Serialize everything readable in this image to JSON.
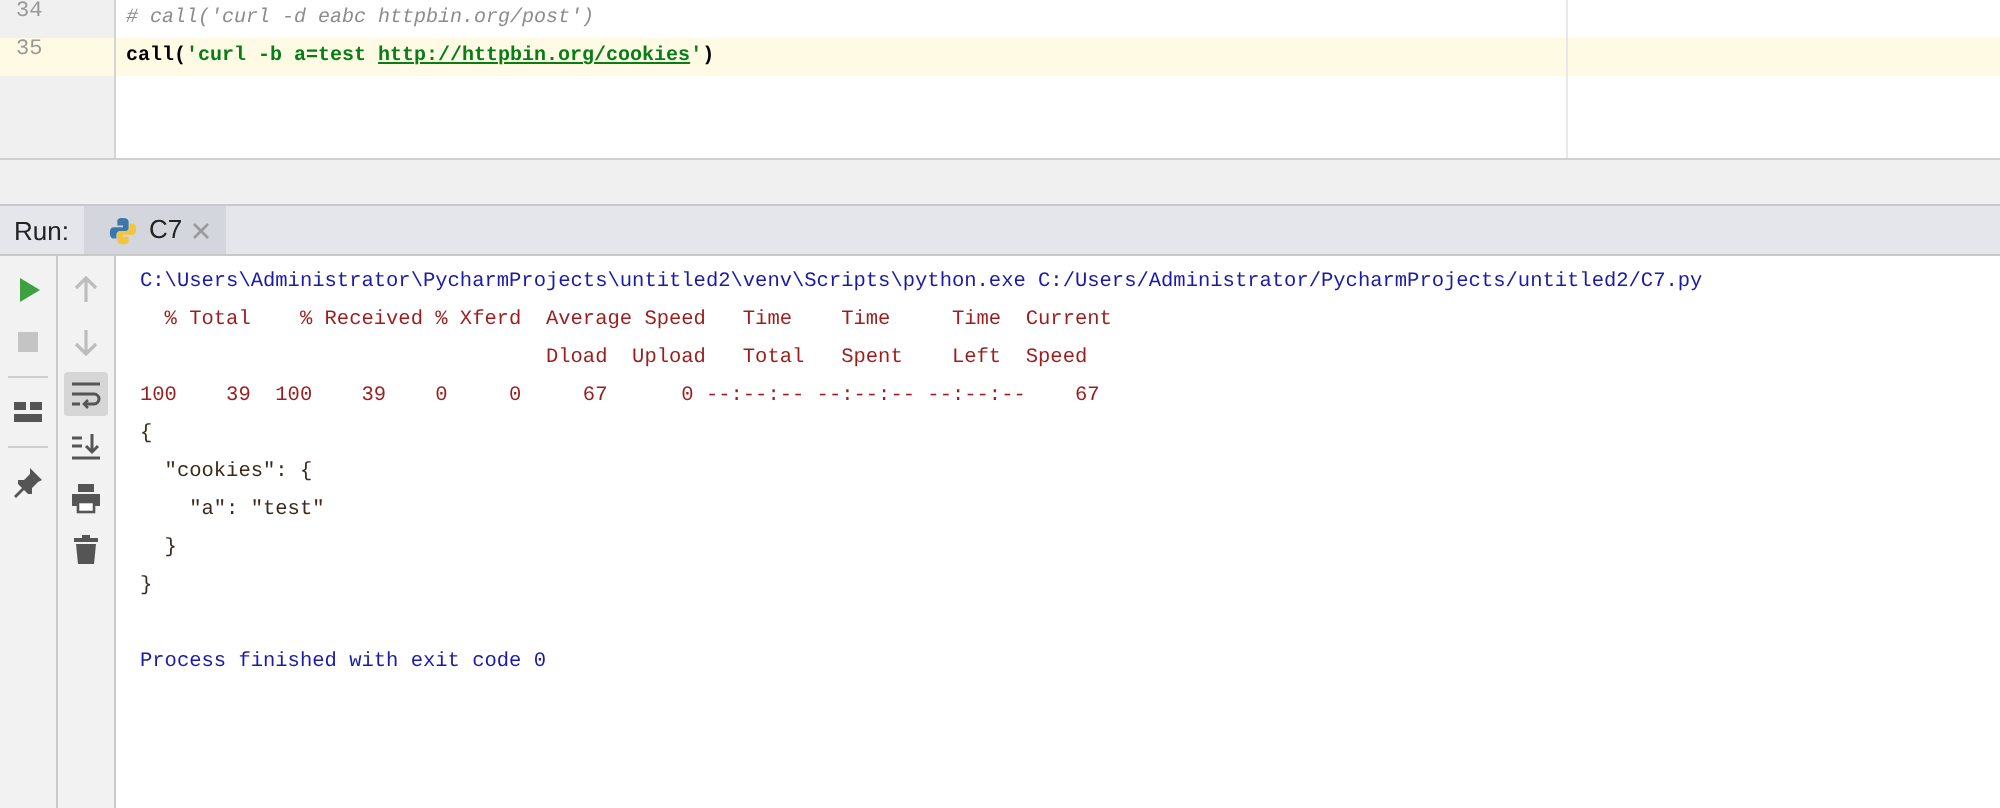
{
  "editor": {
    "lines": [
      {
        "number": "34",
        "current": false,
        "segments": [
          {
            "kind": "comment",
            "text": "# call('curl -d eabc httpbin.org/post')"
          }
        ]
      },
      {
        "number": "35",
        "current": true,
        "segments": [
          {
            "kind": "plain",
            "text": "call("
          },
          {
            "kind": "string",
            "text": "'curl -b a=test "
          },
          {
            "kind": "link",
            "text": "http://httpbin.org/cookies"
          },
          {
            "kind": "string",
            "text": "'"
          },
          {
            "kind": "plain",
            "text": ")"
          }
        ]
      }
    ]
  },
  "run_panel": {
    "label": "Run:",
    "tabs": [
      {
        "label": "C7",
        "selected": true
      }
    ],
    "run_toolbar": [
      {
        "disabled": false
      },
      {
        "disabled": true
      },
      {
        "disabled": false
      },
      {
        "disabled": false
      }
    ],
    "console_toolbar": [
      {
        "disabled": true,
        "selected": false
      },
      {
        "disabled": true,
        "selected": false
      },
      {
        "disabled": false,
        "selected": true
      },
      {
        "disabled": false,
        "selected": false
      },
      {
        "disabled": false,
        "selected": false
      },
      {
        "disabled": false,
        "selected": false
      }
    ],
    "console_lines": [
      {
        "kind": "command",
        "text": "C:\\Users\\Administrator\\PycharmProjects\\untitled2\\venv\\Scripts\\python.exe C:/Users/Administrator/PycharmProjects/untitled2/C7.py"
      },
      {
        "kind": "stderr",
        "text": "  % Total    % Received % Xferd  Average Speed   Time    Time     Time  Current"
      },
      {
        "kind": "stderr",
        "text": "                                 Dload  Upload   Total   Spent    Left  Speed"
      },
      {
        "kind": "stderr",
        "text": "100    39  100    39    0     0     67      0 --:--:-- --:--:-- --:--:--    67"
      },
      {
        "kind": "stdout",
        "text": "{"
      },
      {
        "kind": "stdout",
        "text": "  \"cookies\": {"
      },
      {
        "kind": "stdout",
        "text": "    \"a\": \"test\""
      },
      {
        "kind": "stdout",
        "text": "  }"
      },
      {
        "kind": "stdout",
        "text": "}"
      },
      {
        "kind": "blank"
      },
      {
        "kind": "system",
        "text": "Process finished with exit code 0"
      }
    ]
  }
}
